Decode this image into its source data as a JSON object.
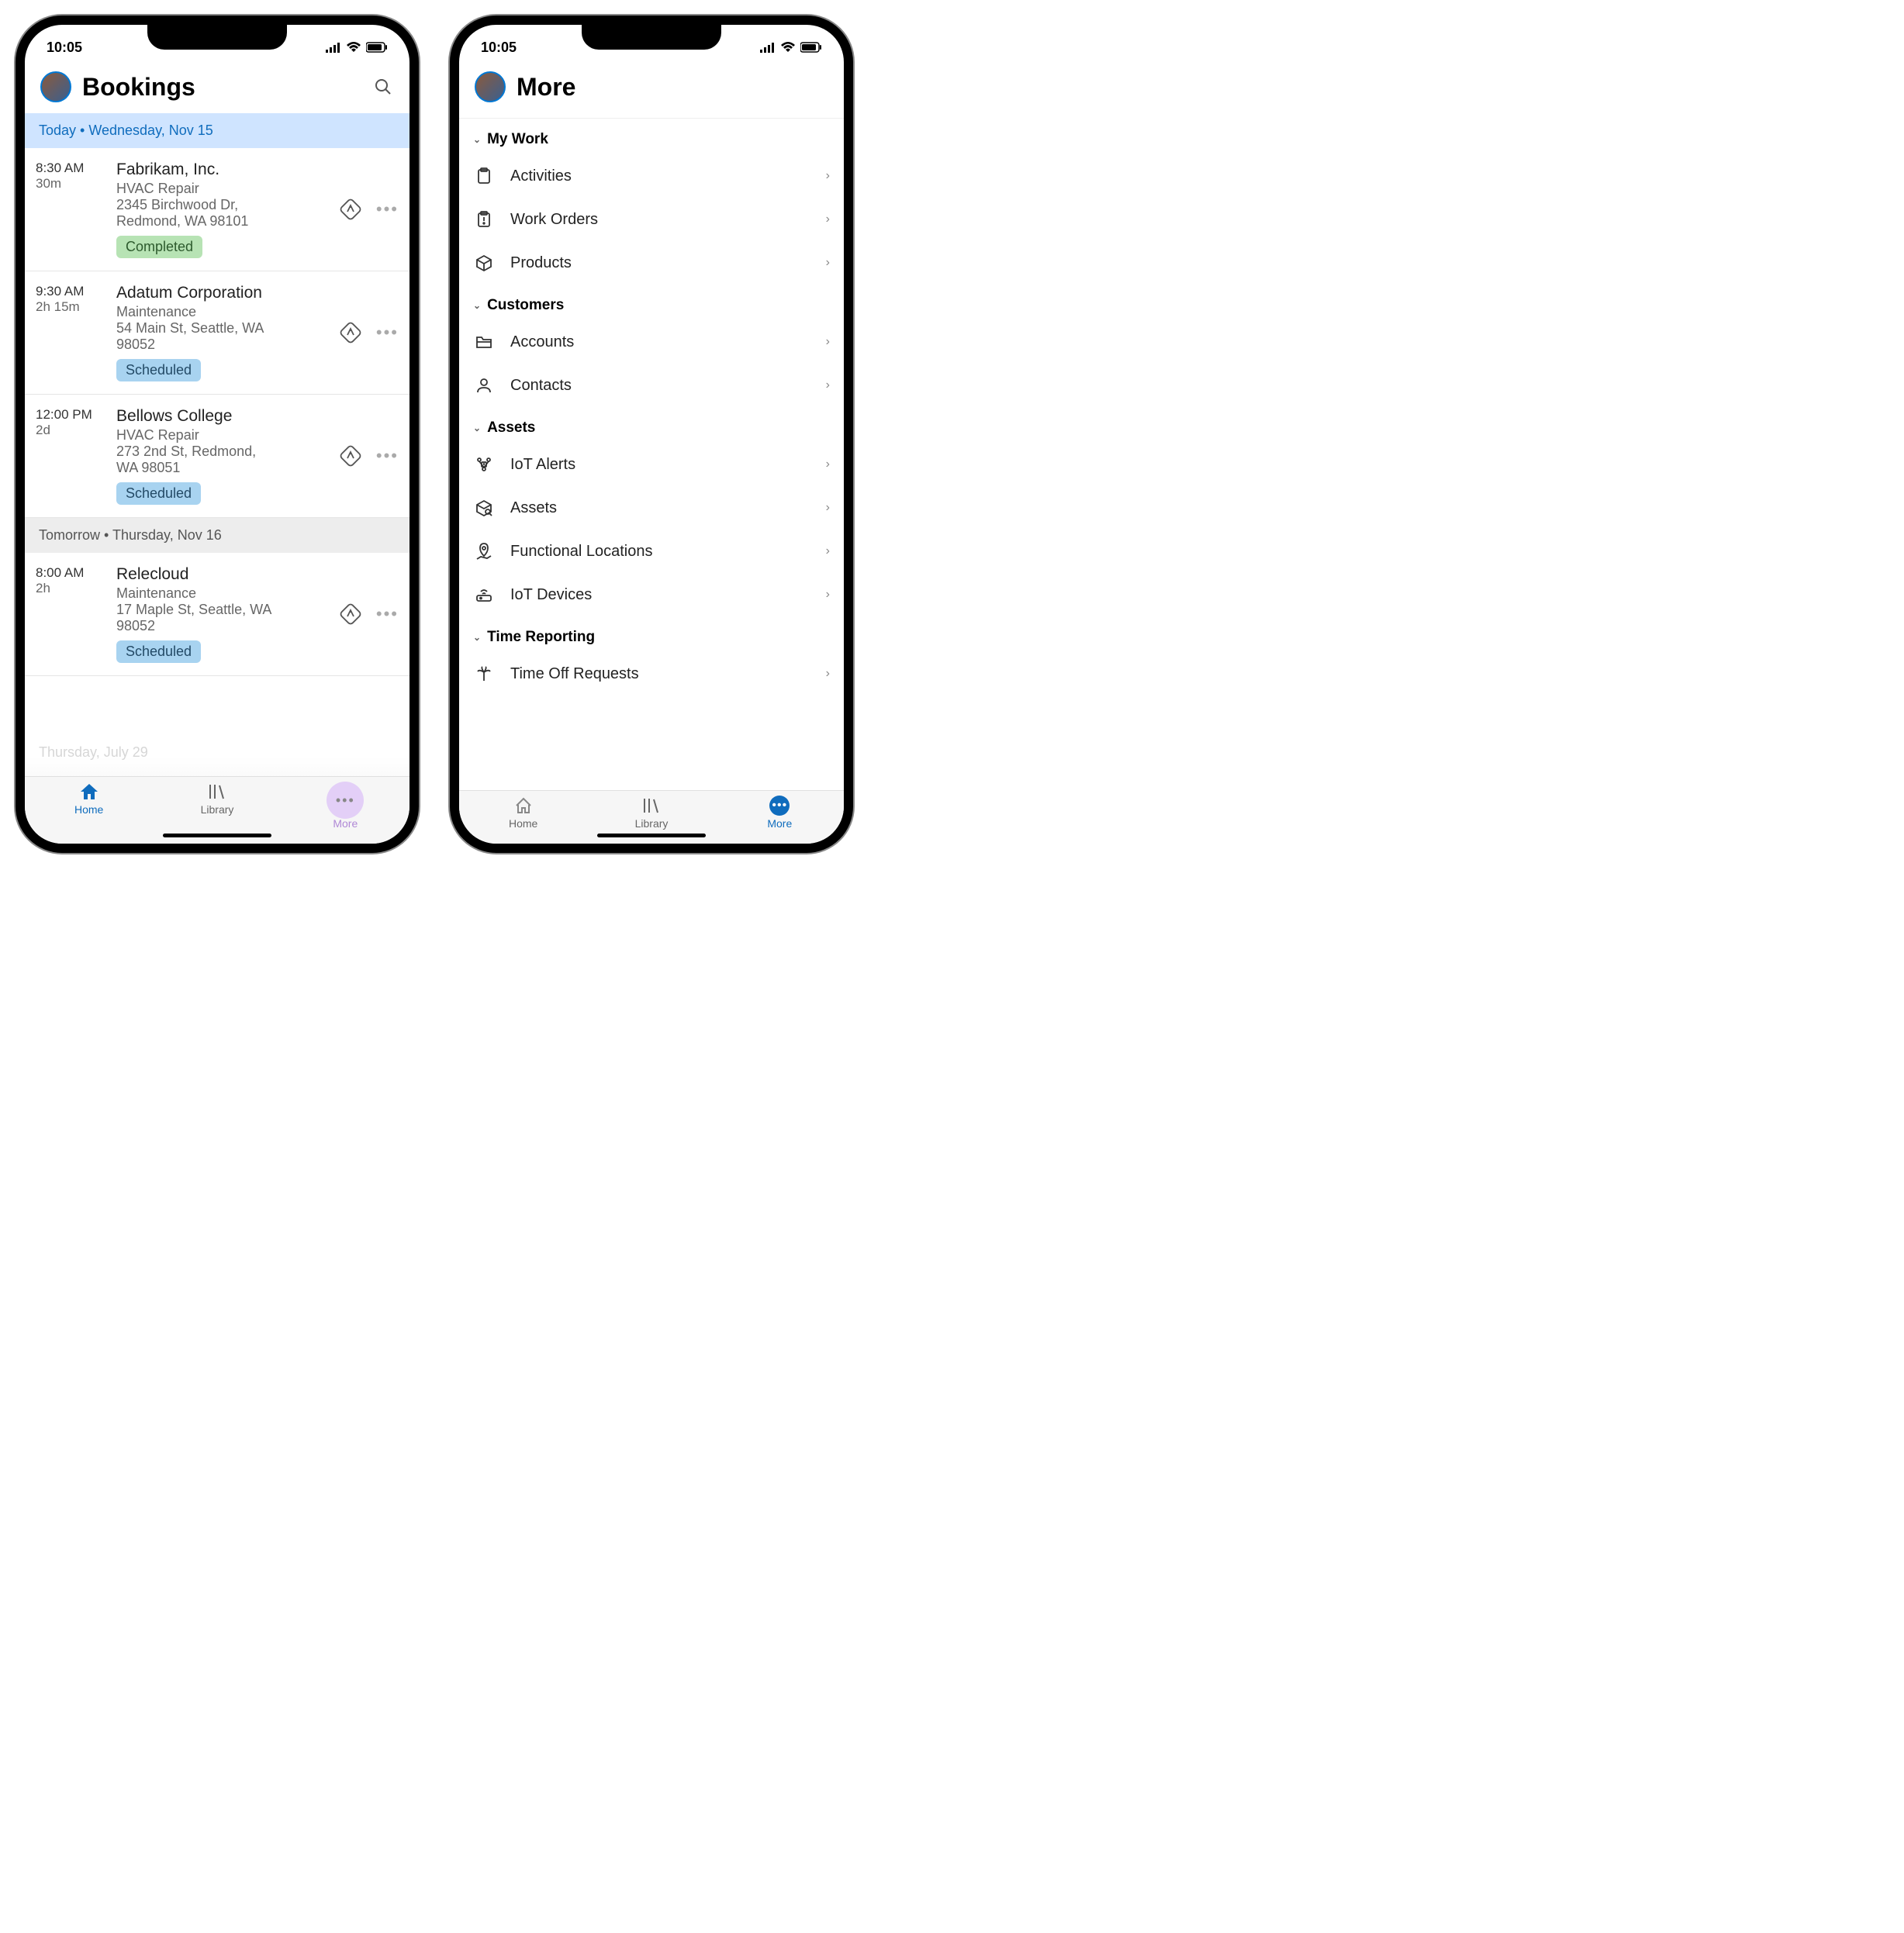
{
  "status": {
    "time": "10:05"
  },
  "left": {
    "title": "Bookings",
    "today_header": "Today • Wednesday, Nov 15",
    "bookings": [
      {
        "time": "8:30 AM",
        "dur": "30m",
        "name": "Fabrikam, Inc.",
        "type": "HVAC Repair",
        "addr1": "2345 Birchwood Dr,",
        "addr2": "Redmond, WA 98101",
        "status": "Completed",
        "pill_class": "pill-completed"
      },
      {
        "time": "9:30 AM",
        "dur": "2h 15m",
        "name": "Adatum Corporation",
        "type": "Maintenance",
        "addr1": "54 Main St, Seattle, WA",
        "addr2": "98052",
        "status": "Scheduled",
        "pill_class": "pill-scheduled"
      },
      {
        "time": "12:00 PM",
        "dur": "2d",
        "name": "Bellows College",
        "type": "HVAC Repair",
        "addr1": "273 2nd St, Redmond,",
        "addr2": "WA 98051",
        "status": "Scheduled",
        "pill_class": "pill-scheduled"
      }
    ],
    "tomorrow_header": "Tomorrow • Thursday, Nov 16",
    "tomorrow": [
      {
        "time": "8:00 AM",
        "dur": "2h",
        "name": "Relecloud",
        "type": "Maintenance",
        "addr1": "17 Maple St, Seattle, WA",
        "addr2": "98052",
        "status": "Scheduled",
        "pill_class": "pill-scheduled"
      }
    ],
    "ghost": "Thursday, July 29",
    "tabs": {
      "home": "Home",
      "library": "Library",
      "more": "More"
    }
  },
  "right": {
    "title": "More",
    "groups": [
      {
        "name": "My Work",
        "items": [
          {
            "label": "Activities",
            "icon": "clipboard"
          },
          {
            "label": "Work Orders",
            "icon": "clipboard-alert"
          },
          {
            "label": "Products",
            "icon": "box"
          }
        ]
      },
      {
        "name": "Customers",
        "items": [
          {
            "label": "Accounts",
            "icon": "folder"
          },
          {
            "label": "Contacts",
            "icon": "person"
          }
        ]
      },
      {
        "name": "Assets",
        "items": [
          {
            "label": "IoT Alerts",
            "icon": "alert-node"
          },
          {
            "label": "Assets",
            "icon": "box-search"
          },
          {
            "label": "Functional Locations",
            "icon": "pin-map"
          },
          {
            "label": "IoT Devices",
            "icon": "router"
          }
        ]
      },
      {
        "name": "Time Reporting",
        "items": [
          {
            "label": "Time Off Requests",
            "icon": "palm"
          }
        ]
      }
    ],
    "tabs": {
      "home": "Home",
      "library": "Library",
      "more": "More"
    }
  }
}
